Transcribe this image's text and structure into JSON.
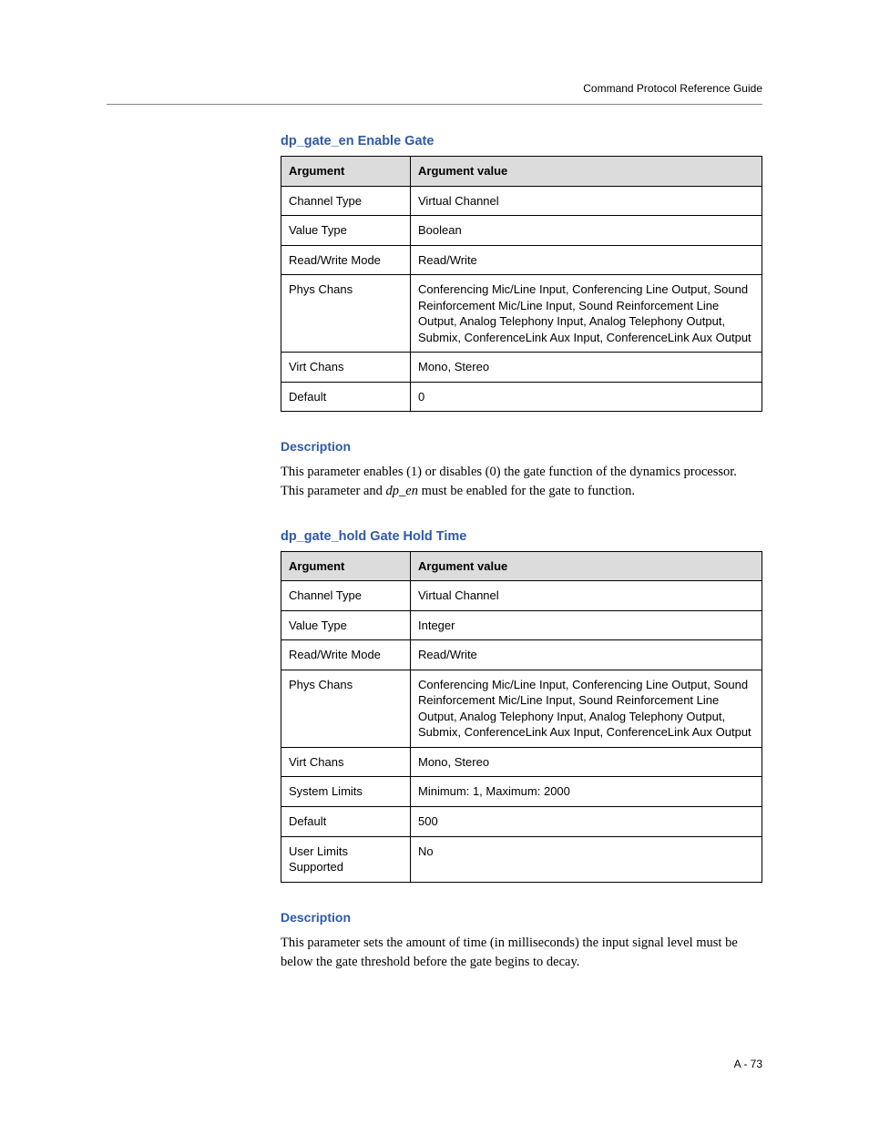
{
  "header": "Command Protocol Reference Guide",
  "footer": "A - 73",
  "section1": {
    "title": "dp_gate_en Enable Gate",
    "header_argument": "Argument",
    "header_value": "Argument value",
    "rows": [
      {
        "arg": "Channel Type",
        "val": "Virtual Channel"
      },
      {
        "arg": "Value Type",
        "val": "Boolean"
      },
      {
        "arg": "Read/Write Mode",
        "val": "Read/Write"
      },
      {
        "arg": "Phys Chans",
        "val": "Conferencing Mic/Line Input, Conferencing Line Output, Sound Reinforcement Mic/Line Input, Sound Reinforcement Line Output, Analog Telephony Input, Analog Telephony Output, Submix, ConferenceLink Aux Input, ConferenceLink Aux Output"
      },
      {
        "arg": "Virt Chans",
        "val": "Mono, Stereo"
      },
      {
        "arg": "Default",
        "val": "0"
      }
    ],
    "desc_heading": "Description",
    "desc_pre": "This parameter enables (1) or disables (0) the gate function of the dynamics processor. This parameter and ",
    "desc_em": "dp_en",
    "desc_post": " must be enabled for the gate to function."
  },
  "section2": {
    "title": "dp_gate_hold Gate Hold Time",
    "header_argument": "Argument",
    "header_value": "Argument value",
    "rows": [
      {
        "arg": "Channel Type",
        "val": "Virtual Channel"
      },
      {
        "arg": "Value Type",
        "val": "Integer"
      },
      {
        "arg": "Read/Write Mode",
        "val": "Read/Write"
      },
      {
        "arg": "Phys Chans",
        "val": "Conferencing Mic/Line Input, Conferencing Line Output, Sound Reinforcement Mic/Line Input, Sound Reinforcement Line Output, Analog Telephony Input, Analog Telephony Output, Submix, ConferenceLink Aux Input, ConferenceLink Aux Output"
      },
      {
        "arg": "Virt Chans",
        "val": "Mono, Stereo"
      },
      {
        "arg": "System Limits",
        "val": "Minimum: 1, Maximum: 2000"
      },
      {
        "arg": "Default",
        "val": "500"
      },
      {
        "arg": "User Limits Supported",
        "val": "No"
      }
    ],
    "desc_heading": "Description",
    "desc_text": "This parameter sets the amount of time (in milliseconds) the input signal level must be below the gate threshold before the gate begins to decay."
  }
}
